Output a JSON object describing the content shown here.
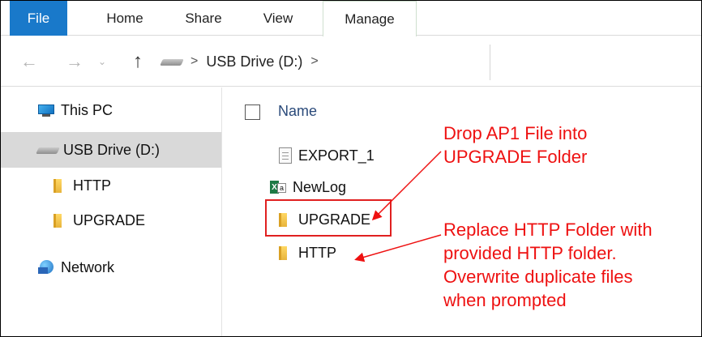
{
  "ribbon": {
    "tabs": [
      {
        "label": "File"
      },
      {
        "label": "Home"
      },
      {
        "label": "Share"
      },
      {
        "label": "View"
      },
      {
        "label": "Manage"
      }
    ]
  },
  "address": {
    "back_icon": "back-arrow-icon",
    "forward_icon": "forward-arrow-icon",
    "recent_icon": "chevron-down-icon",
    "up_icon": "up-arrow-icon",
    "separator": ">",
    "path": [
      "USB Drive (D:)"
    ]
  },
  "sidebar": {
    "items": [
      {
        "label": "This PC",
        "icon": "pc-icon"
      },
      {
        "label": "USB Drive (D:)",
        "icon": "drive-icon",
        "selected": true
      },
      {
        "label": "HTTP",
        "icon": "folder-icon"
      },
      {
        "label": "UPGRADE",
        "icon": "folder-icon"
      },
      {
        "label": "Network",
        "icon": "network-icon"
      }
    ]
  },
  "filelist": {
    "header": {
      "name_label": "Name"
    },
    "files": [
      {
        "name": "EXPORT_1",
        "icon": "document-icon"
      },
      {
        "name": "NewLog",
        "icon": "excel-icon"
      },
      {
        "name": "UPGRADE",
        "icon": "folder-icon",
        "highlighted": true
      },
      {
        "name": "HTTP",
        "icon": "folder-icon"
      }
    ]
  },
  "annotations": {
    "note1": [
      "Drop AP1 File into",
      "UPGRADE Folder"
    ],
    "note2": [
      "Replace HTTP Folder with",
      "provided HTTP folder.",
      "Overwrite duplicate files",
      "when prompted"
    ],
    "color": "#ee1111"
  },
  "colors": {
    "file_tab": "#1979ca",
    "selection": "#d9d9d9"
  }
}
